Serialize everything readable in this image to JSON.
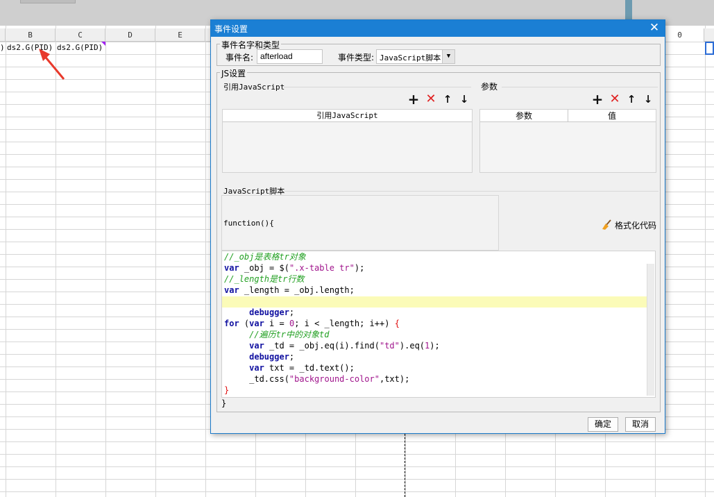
{
  "spreadsheet": {
    "columns": [
      {
        "label": "B"
      },
      {
        "label": "C"
      },
      {
        "label": "D"
      },
      {
        "label": "E"
      },
      {
        "label": "0"
      }
    ],
    "cells": [
      {
        "text": ")"
      },
      {
        "text": "ds2.G(PID)"
      },
      {
        "text": "ds2.G(PID)"
      }
    ]
  },
  "dialog": {
    "title": "事件设置",
    "name_group": {
      "legend": "事件名字和类型",
      "event_name_label": "事件名:",
      "event_name_value": "afterload",
      "event_type_label": "事件类型:",
      "event_type_value": "JavaScript脚本"
    },
    "js_group": {
      "legend": "JS设置",
      "ref_js_title": "引用JavaScript",
      "params_title": "参数",
      "ref_js_column": "引用JavaScript",
      "param_columns": [
        "参数",
        "值"
      ],
      "script_title": "JavaScript脚本",
      "function_header": "function(){",
      "format_button": "格式化代码",
      "code_lines": [
        "//_obj是表格tr对象",
        "var _obj = $(\".x-table tr\");",
        "//_length是tr行数",
        "var _length = _obj.length;",
        "",
        "     debugger;",
        "for (var i = 0; i < _length; i++) {",
        "     //遍历tr中的对象td",
        "     var _td = _obj.eq(i).find(\"td\").eq(1);",
        "     debugger;",
        "     var txt = _td.text();",
        "     _td.css(\"background-color\",txt);",
        "}"
      ],
      "closing_brace": "}"
    },
    "ok_button": "确定",
    "cancel_button": "取消"
  }
}
